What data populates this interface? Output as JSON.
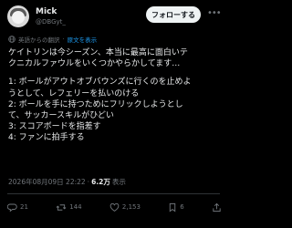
{
  "author": {
    "name": "Mick",
    "handle": "@DBGyt_"
  },
  "follow_button": "フォローする",
  "translation": {
    "label": "英語からの翻訳",
    "separator": "·",
    "show_original": "原文を表示"
  },
  "tweet": {
    "lines": [
      "ケイトリンは今シーズン、本当に最高に面白いテ",
      "クニカルファウルをいくつかやらかしてます…",
      "",
      "1: ボールがアウトオブバウンズに行くのを止めよ",
      "うとして、レフェリーを払いのける",
      "2: ボールを手に持つためにフリックしようとし",
      "て、サッカースキルがひどい",
      "3: スコアボードを指差す",
      "4: ファンに拍手する"
    ]
  },
  "meta": {
    "datetime": "2026年08月09日 22:22",
    "dot": "·",
    "views_count": "6.2万",
    "views_label": "表示"
  },
  "actions": {
    "replies": "21",
    "reposts": "144",
    "likes": "2,153",
    "bookmarks": "6"
  },
  "icons": {
    "reply": "reply-icon",
    "repost": "repost-icon",
    "like": "heart-icon",
    "bookmark": "bookmark-icon",
    "share": "share-icon",
    "globe": "globe-icon",
    "more": "more-icon"
  },
  "colors": {
    "background": "#000000",
    "text": "#e7e9ea",
    "secondary": "#71767b",
    "link": "#1d9bf0",
    "button_bg": "#eff3f4"
  }
}
